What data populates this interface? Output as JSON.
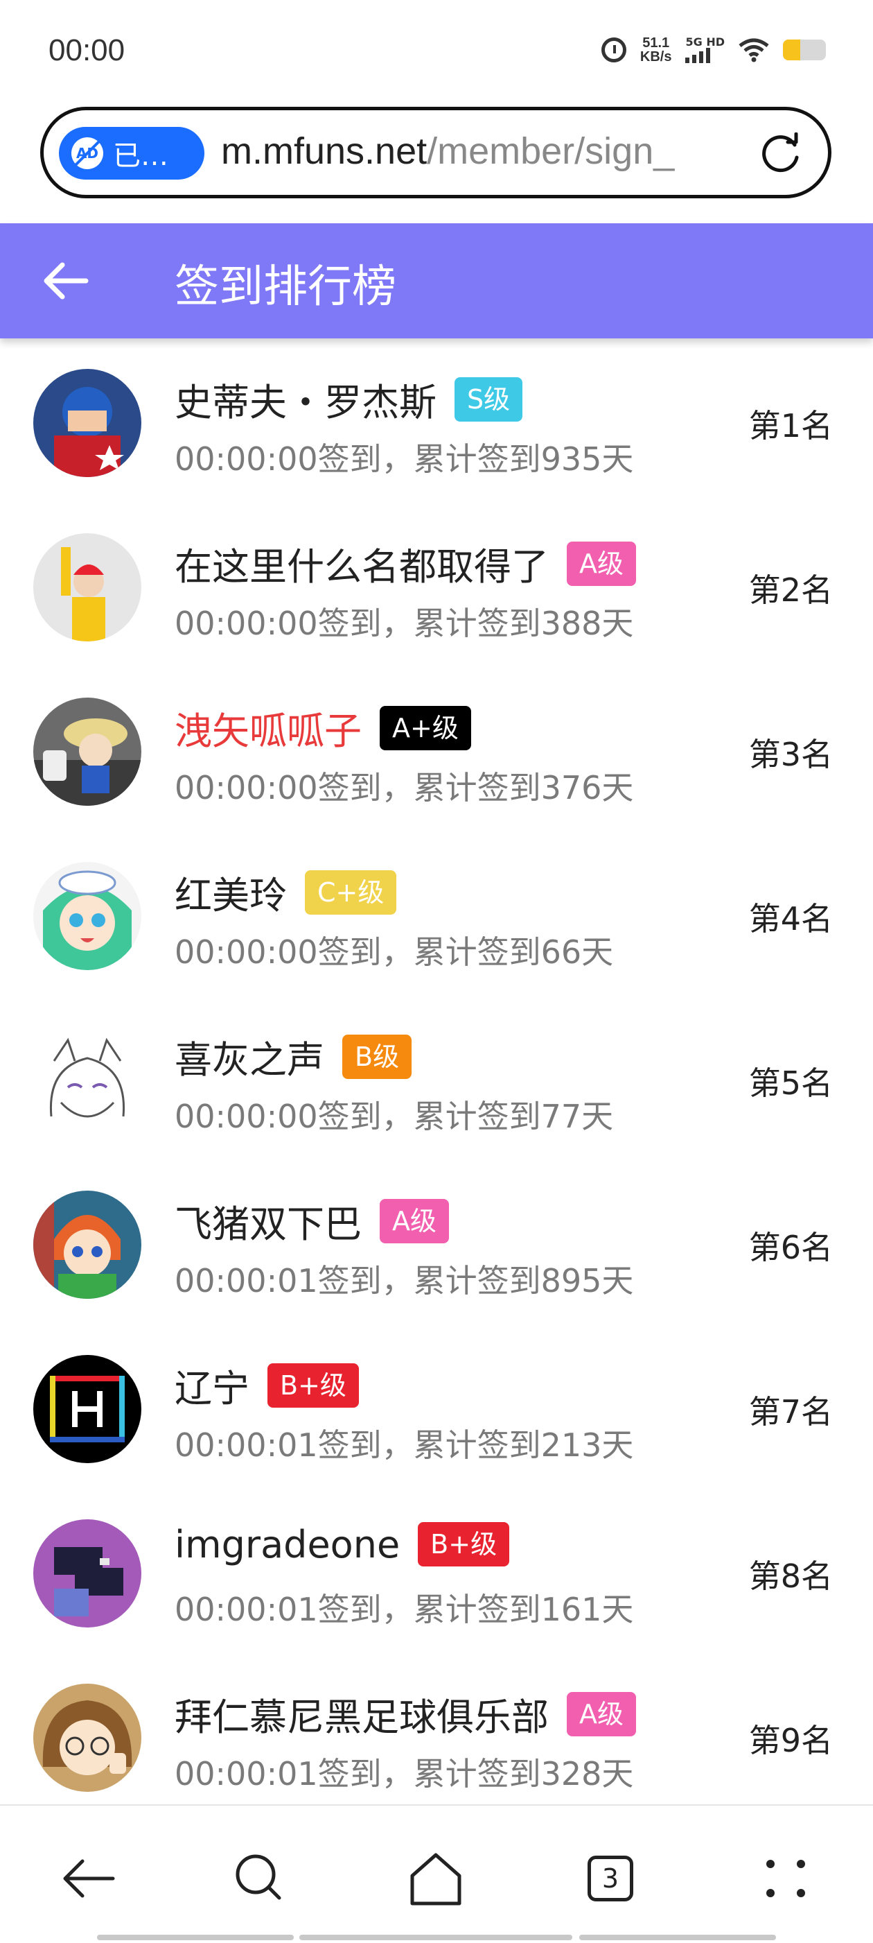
{
  "status": {
    "time": "00:00",
    "net_speed_value": "51.1",
    "net_speed_unit": "KB/s",
    "signal_label": "5G HD",
    "battery_level": 0.4
  },
  "browser": {
    "ad_label": "已…",
    "url_host": "m.mfuns.net",
    "url_path": "/member/sign_"
  },
  "header": {
    "title": "签到排行榜"
  },
  "entries": [
    {
      "name": "史蒂夫・罗杰斯",
      "badge": "S级",
      "badge_color": "#3ec9e6",
      "sub": "00:00:00签到，累计签到935天",
      "rank": "第1名",
      "name_color": "#222222"
    },
    {
      "name": "在这里什么名都取得了",
      "badge": "A级",
      "badge_color": "#f25fae",
      "sub": "00:00:00签到，累计签到388天",
      "rank": "第2名",
      "name_color": "#222222"
    },
    {
      "name": "洩矢呱呱子",
      "badge": "A+级",
      "badge_color": "#000000",
      "sub": "00:00:00签到，累计签到376天",
      "rank": "第3名",
      "name_color": "#e83a3a"
    },
    {
      "name": "红美玲",
      "badge": "C+级",
      "badge_color": "#f0d34a",
      "sub": "00:00:00签到，累计签到66天",
      "rank": "第4名",
      "name_color": "#222222"
    },
    {
      "name": "喜灰之声",
      "badge": "B级",
      "badge_color": "#f58a0e",
      "sub": "00:00:00签到，累计签到77天",
      "rank": "第5名",
      "name_color": "#222222"
    },
    {
      "name": "飞猪双下巴",
      "badge": "A级",
      "badge_color": "#f25fae",
      "sub": "00:00:01签到，累计签到895天",
      "rank": "第6名",
      "name_color": "#222222"
    },
    {
      "name": "辽宁",
      "badge": "B+级",
      "badge_color": "#e8232f",
      "sub": "00:00:01签到，累计签到213天",
      "rank": "第7名",
      "name_color": "#222222"
    },
    {
      "name": "imgradeone",
      "badge": "B+级",
      "badge_color": "#e8232f",
      "sub": "00:00:01签到，累计签到161天",
      "rank": "第8名",
      "name_color": "#222222"
    },
    {
      "name": "拜仁慕尼黑足球俱乐部",
      "badge": "A级",
      "badge_color": "#f25fae",
      "sub": "00:00:01签到，累计签到328天",
      "rank": "第9名",
      "name_color": "#222222"
    }
  ],
  "bottom_nav": {
    "tab_count": "3"
  }
}
